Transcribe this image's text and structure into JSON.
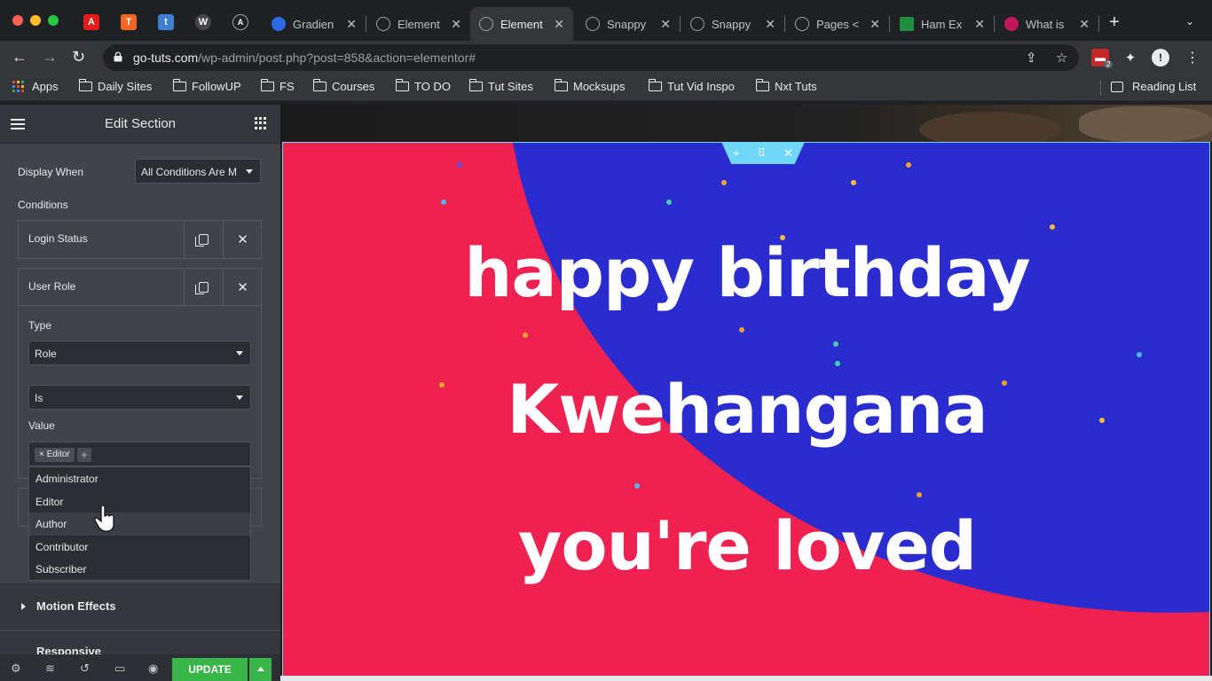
{
  "browser": {
    "tabs": [
      {
        "title": "Gradien"
      },
      {
        "title": "Element"
      },
      {
        "title": "Element"
      },
      {
        "title": "Snappy"
      },
      {
        "title": "Snappy"
      },
      {
        "title": "Pages <"
      },
      {
        "title": "Ham Ex"
      },
      {
        "title": "What is"
      }
    ],
    "active_tab": 2,
    "url_host": "go-tuts.com",
    "url_path": "/wp-admin/post.php?post=858&action=elementor#",
    "extension_badge": "2",
    "bookmarks": [
      "Apps",
      "Daily Sites",
      "FollowUP",
      "FS",
      "Courses",
      "TO DO",
      "Tut Sites",
      "Mocksups",
      "Tut Vid Inspo",
      "Nxt Tuts"
    ],
    "reading_list": "Reading List"
  },
  "panel": {
    "title": "Edit Section",
    "display_when_label": "Display When",
    "display_when_value": "All Conditions Are M",
    "conditions_label": "Conditions",
    "repeater_items": [
      {
        "title": "Login Status"
      },
      {
        "title": "User Role"
      }
    ],
    "type_label": "Type",
    "type_value": "Role",
    "operator_value": "Is",
    "value_label": "Value",
    "selected_tag": "× Editor",
    "tag_add": "+",
    "dropdown_options": [
      "Administrator",
      "Editor",
      "Author",
      "Contributor",
      "Subscriber"
    ],
    "highlighted_option": "Author",
    "motion_effects": "Motion Effects",
    "responsive_partial": "Responsive",
    "update_label": "UPDATE"
  },
  "canvas": {
    "headline_lines": [
      "happy birthday",
      "Kwehangana",
      "you're loved"
    ],
    "colors": {
      "pink": "#ee2150",
      "blue": "#2a2ccf",
      "handle": "#71d7f7"
    }
  }
}
